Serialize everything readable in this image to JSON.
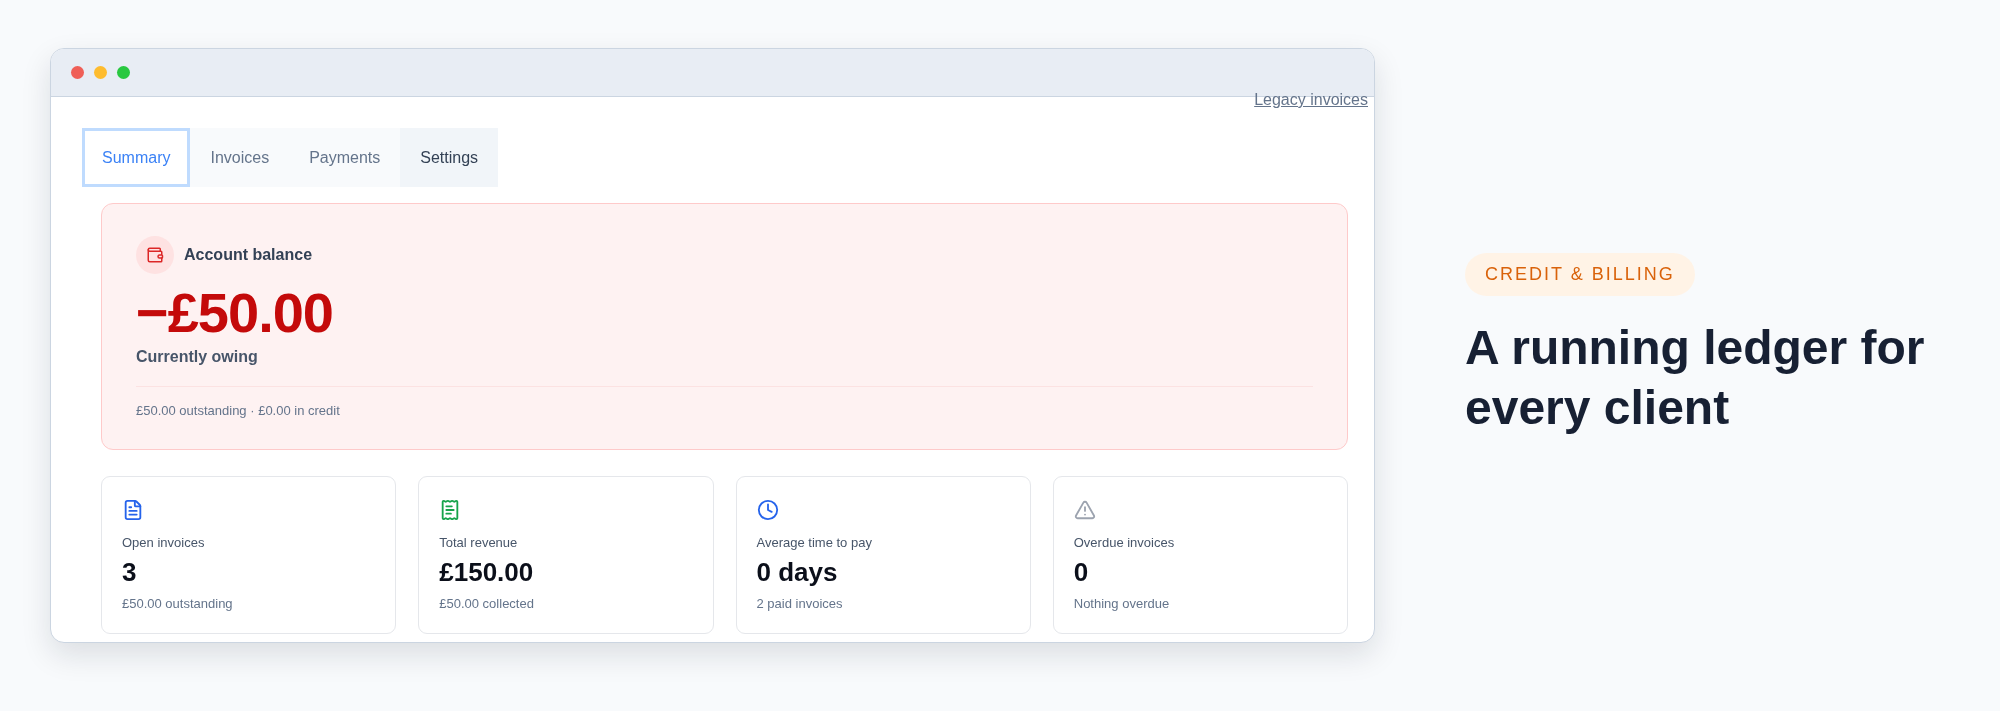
{
  "window": {
    "link": "Legacy invoices"
  },
  "tabs": [
    {
      "label": "Summary",
      "selected": true
    },
    {
      "label": "Invoices",
      "selected": false
    },
    {
      "label": "Payments",
      "selected": false
    },
    {
      "label": "Settings",
      "selected": false
    }
  ],
  "balance": {
    "label": "Account balance",
    "amount": "−£50.00",
    "status": "Currently owing",
    "detail": "£50.00 outstanding · £0.00 in credit"
  },
  "stats": [
    {
      "kind": "document",
      "color": "#2563eb",
      "label": "Open invoices",
      "value": "3",
      "note": "£50.00 outstanding"
    },
    {
      "kind": "receipt",
      "color": "#16a34a",
      "label": "Total revenue",
      "value": "£150.00",
      "note": "£50.00 collected"
    },
    {
      "kind": "clock",
      "color": "#2563eb",
      "label": "Average time to pay",
      "value": "0 days",
      "note": "2 paid invoices"
    },
    {
      "kind": "warning",
      "color": "#9ca3af",
      "label": "Overdue invoices",
      "value": "0",
      "note": "Nothing overdue"
    }
  ],
  "feature": {
    "badge": "CREDIT & BILLING",
    "heading": "A running ledger for every client"
  }
}
